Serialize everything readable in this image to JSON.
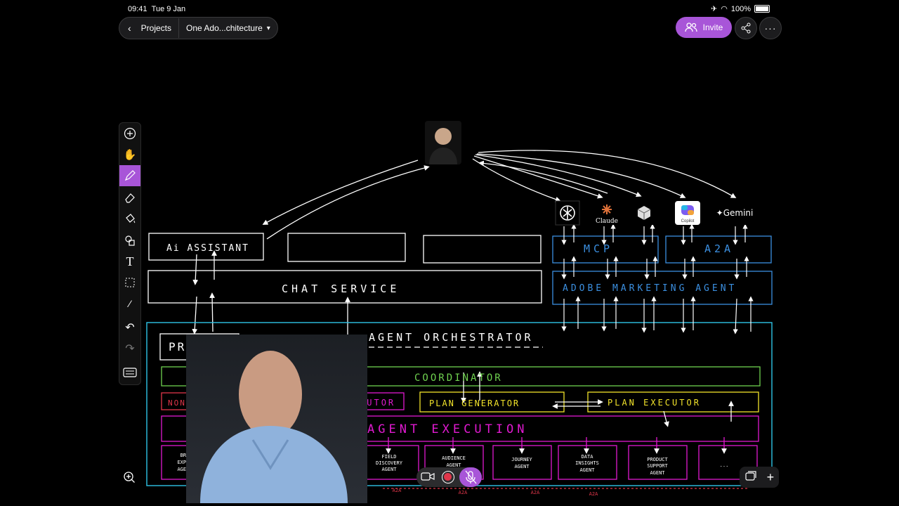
{
  "status_bar": {
    "time": "09:41",
    "date": "Tue 9 Jan",
    "battery": "100%"
  },
  "nav": {
    "back_label": "Projects",
    "doc_title": "One Ado...chitecture"
  },
  "actions": {
    "invite_label": "Invite"
  },
  "logos": {
    "openai": "",
    "claude": "Claude",
    "perplexity": "",
    "copilot": "Copilot",
    "gemini": "✦Gemini"
  },
  "diagram": {
    "ai_assistant": "Ai ASSISTANT",
    "chat_service": "CHAT SERVICE",
    "mcp": "MCP",
    "a2a": "A2A",
    "adobe_marketing_agent": "ADOBE MARKETING AGENT",
    "prompt": "PROMPT",
    "agent_orchestrator": "AGENT ORCHESTRATOR",
    "coordinator": "COORDINATOR",
    "non_agent_query": "NON AGENT QU",
    "agent_executor": "AGENT EXECUTOR",
    "plan_generator": "PLAN GENERATOR",
    "plan_executor": "PLAN EXECUTOR",
    "agent_execution": "AGENT EXECUTION",
    "agents": [
      {
        "line1": "BRA",
        "line2": "EXPER",
        "line3": "AGENT"
      },
      {
        "line1": "FIELD",
        "line2": "DISCOVERY",
        "line3": "AGENT"
      },
      {
        "line1": "AUDIENCE",
        "line2": "AGENT",
        "line3": ""
      },
      {
        "line1": "JOURNEY",
        "line2": "AGENT",
        "line3": ""
      },
      {
        "line1": "DATA",
        "line2": "INSIGHTS",
        "line3": "AGENT"
      },
      {
        "line1": "PRODUCT",
        "line2": "SUPPORT",
        "line3": "AGENT"
      },
      {
        "line1": "...",
        "line2": "",
        "line3": ""
      }
    ],
    "a2a_small": "A2A"
  },
  "colors": {
    "accent": "#a855d8",
    "cyan": "#2ec4e6",
    "green": "#6fd14f",
    "magenta": "#e01ad0",
    "yellow": "#f2e32a",
    "blue": "#3b8fe0",
    "red": "#e0364a"
  }
}
